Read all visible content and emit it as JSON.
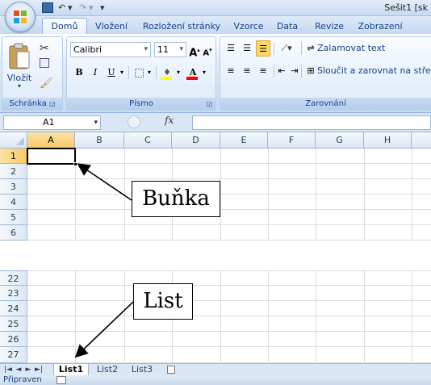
{
  "titlebar": {
    "title": "Sešit1  [sk",
    "quick_access": {
      "undo": "↶",
      "redo": "↷",
      "more": "▾"
    }
  },
  "tabs": [
    "Domů",
    "Vložení",
    "Rozložení stránky",
    "Vzorce",
    "Data",
    "Revize",
    "Zobrazení"
  ],
  "ribbon": {
    "clipboard": {
      "label": "Schránka",
      "paste": "Vložit"
    },
    "font": {
      "label": "Písmo",
      "name": "Calibri",
      "size": "11",
      "bold": "B",
      "italic": "I",
      "underline": "U",
      "grow": "A",
      "shrink": "A"
    },
    "alignment": {
      "label": "Zarovnání",
      "wrap": "Zalamovat text",
      "merge": "Sloučit a zarovnat na střed"
    }
  },
  "formula_bar": {
    "name_box": "A1",
    "fx": "fx",
    "value": ""
  },
  "columns": [
    "A",
    "B",
    "C",
    "D",
    "E",
    "F",
    "G",
    "H"
  ],
  "rows_top": [
    "1",
    "2",
    "3",
    "4",
    "5",
    "6"
  ],
  "rows_bottom": [
    "22",
    "23",
    "24",
    "25",
    "26",
    "27"
  ],
  "sheets": {
    "nav": [
      "|◄",
      "◄",
      "►",
      "►|"
    ],
    "tabs": [
      "List1",
      "List2",
      "List3"
    ],
    "active": "List1"
  },
  "status": {
    "text": "Připraven"
  },
  "callouts": {
    "cell": "Buňka",
    "sheet": "List"
  },
  "colors": {
    "accent": "#15428b",
    "selection_border": "#000000",
    "grid": "#dadcdd"
  }
}
